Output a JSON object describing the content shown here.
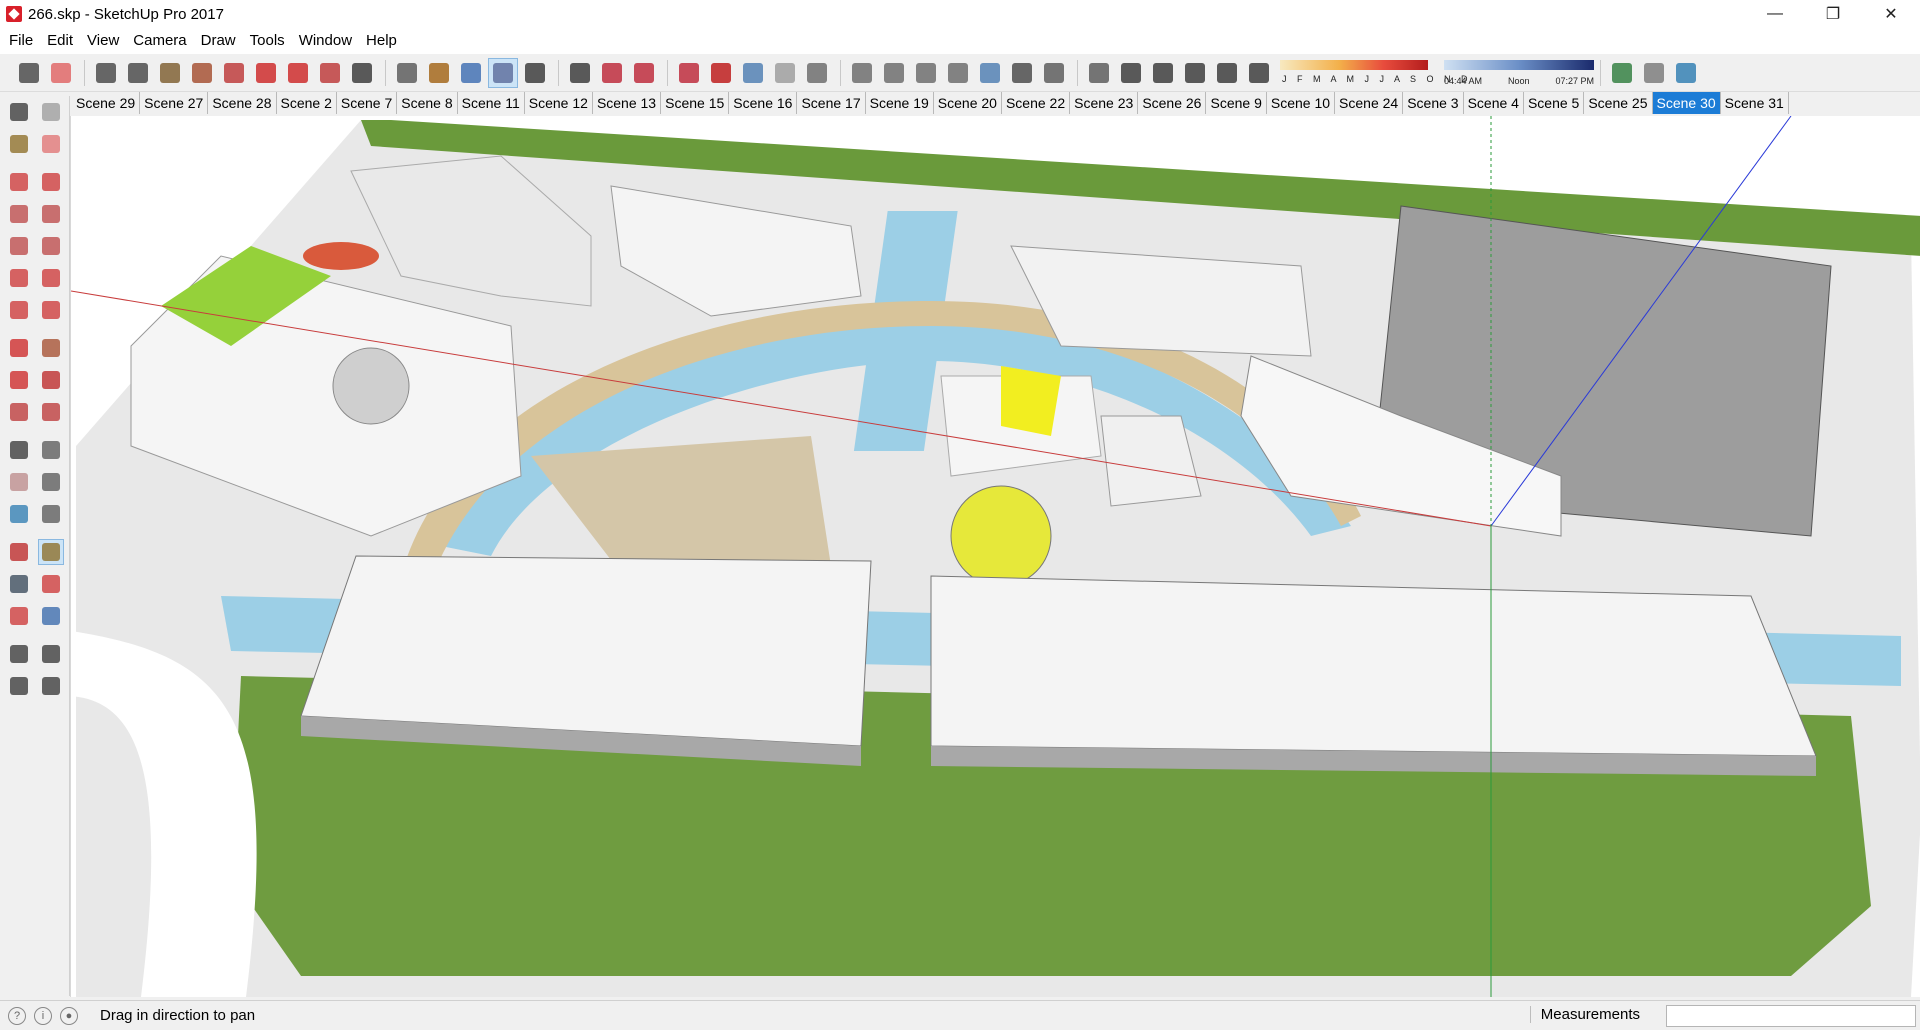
{
  "window": {
    "title": "266.skp - SketchUp Pro 2017",
    "minimize": "—",
    "maximize": "❐",
    "close": "✕"
  },
  "menu": [
    "File",
    "Edit",
    "View",
    "Camera",
    "Draw",
    "Tools",
    "Window",
    "Help"
  ],
  "toolbar": {
    "icons": [
      "select-icon",
      "eraser-icon",
      "pencil-icon",
      "arc-icon",
      "paint-bucket-icon",
      "push-pull-icon",
      "follow-me-icon",
      "move-icon",
      "rotate-icon",
      "scale-icon",
      "tape-measure-icon",
      "text-icon",
      "paint-icon",
      "orbit-icon",
      "pan-icon",
      "zoom-icon",
      "zoom-extents-icon",
      "warehouse-icon",
      "extension-warehouse-icon",
      "layout-icon",
      "ruby-icon",
      "section-plane-icon",
      "section-fill-icon",
      "x-ray-icon",
      "back-edges-icon",
      "wireframe-icon",
      "hidden-line-icon",
      "shaded-icon",
      "shaded-textures-icon",
      "monochrome-icon",
      "iso-view-icon",
      "top-view-icon",
      "front-view-icon",
      "right-view-icon",
      "back-view-icon",
      "left-view-icon",
      "shadows-toggle-icon",
      "geo-location-icon",
      "sandbox-icon",
      "photo-match-icon"
    ],
    "shadow_months": "J F M A M J J A S O N D",
    "shadow_time_start": "04:44 AM",
    "shadow_time_mid": "Noon",
    "shadow_time_end": "07:27 PM"
  },
  "scenes": {
    "tabs": [
      "Scene 29",
      "Scene 27",
      "Scene 28",
      "Scene 2",
      "Scene 7",
      "Scene 8",
      "Scene 11",
      "Scene 12",
      "Scene 13",
      "Scene 15",
      "Scene 16",
      "Scene 17",
      "Scene 19",
      "Scene 20",
      "Scene 22",
      "Scene 23",
      "Scene 26",
      "Scene 9",
      "Scene 10",
      "Scene 24",
      "Scene 3",
      "Scene 4",
      "Scene 5",
      "Scene 25",
      "Scene 30",
      "Scene 31"
    ],
    "active": "Scene 30"
  },
  "left_tools": [
    [
      "select-icon",
      "component-icon"
    ],
    [
      "paint-bucket-icon",
      "eraser-icon"
    ],
    [
      "line-icon",
      "freehand-icon"
    ],
    [
      "rectangle-icon",
      "rotated-rectangle-icon"
    ],
    [
      "circle-icon",
      "polygon-icon"
    ],
    [
      "arc-icon",
      "two-point-arc-icon"
    ],
    [
      "three-point-arc-icon",
      "pie-icon"
    ],
    [
      "move-icon",
      "push-pull-icon"
    ],
    [
      "rotate-icon",
      "follow-me-icon"
    ],
    [
      "scale-icon",
      "offset-icon"
    ],
    [
      "tape-measure-icon",
      "dimension-icon"
    ],
    [
      "protractor-icon",
      "text-icon"
    ],
    [
      "axes-icon",
      "3d-text-icon"
    ],
    [
      "orbit-icon",
      "pan-icon"
    ],
    [
      "zoom-icon",
      "zoom-window-icon"
    ],
    [
      "zoom-extents-icon",
      "previous-view-icon"
    ],
    [
      "walk-icon",
      "look-around-icon"
    ],
    [
      "footprints-icon",
      "position-camera-icon"
    ]
  ],
  "status": {
    "hint": "Drag in direction to pan",
    "measurements_label": "Measurements",
    "measurements_value": ""
  },
  "colors": {
    "active_tab": "#1c7cd6",
    "grass": "#6a9a3b",
    "water": "#9ccfe6",
    "axis_red": "#c83c3c",
    "axis_green": "#2a9a3a",
    "axis_blue": "#2a3ad8"
  }
}
